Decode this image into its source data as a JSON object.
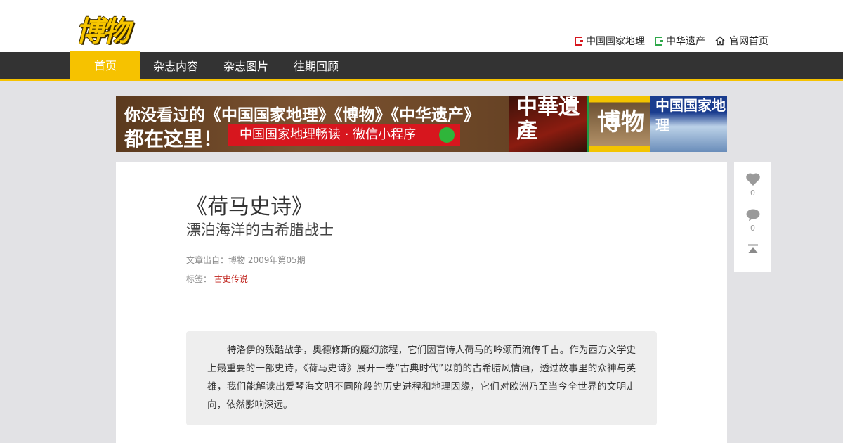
{
  "header": {
    "logo_text": "博物",
    "links": [
      {
        "label": "中国国家地理",
        "icon": "brand-mark-icon",
        "color": "#d7161e"
      },
      {
        "label": "中华遗产",
        "icon": "brand-mark-icon",
        "color": "#2fa84a"
      },
      {
        "label": "官网首页",
        "icon": "home-icon"
      }
    ]
  },
  "nav": {
    "items": [
      {
        "label": "首页",
        "active": true
      },
      {
        "label": "杂志内容"
      },
      {
        "label": "杂志图片"
      },
      {
        "label": "往期回顾"
      }
    ]
  },
  "banner": {
    "line1": "你没看过的《中国国家地理》《博物》《中华遗产》",
    "line2": "都在这里！",
    "pill": "中国国家地理畅读 · 微信小程序",
    "magazine_covers": [
      "中華遺產",
      "博物",
      "中国国家地理"
    ]
  },
  "article": {
    "title": "《荷马史诗》",
    "subtitle": "漂泊海洋的古希腊战士",
    "source": "文章出自：博物 2009年第05期",
    "tags_label": "标签：",
    "tag": "古史传说",
    "summary": "特洛伊的残酷战争，奥德修斯的魔幻旅程，它们因盲诗人荷马的吟颂而流传千古。作为西方文学史上最重要的一部史诗，《荷马史诗》展开一卷“古典时代”以前的古希腊风情画，透过故事里的众神与英雄，我们能解读出爱琴海文明不同阶段的历史进程和地理因缘，它们对欧洲乃至当今全世界的文明走向，依然影响深远。"
  },
  "side_actions": {
    "like_count": "0",
    "comment_count": "0"
  },
  "colors": {
    "accent": "#f6c200",
    "nav_bg": "#333333",
    "tag": "#c0231c"
  }
}
